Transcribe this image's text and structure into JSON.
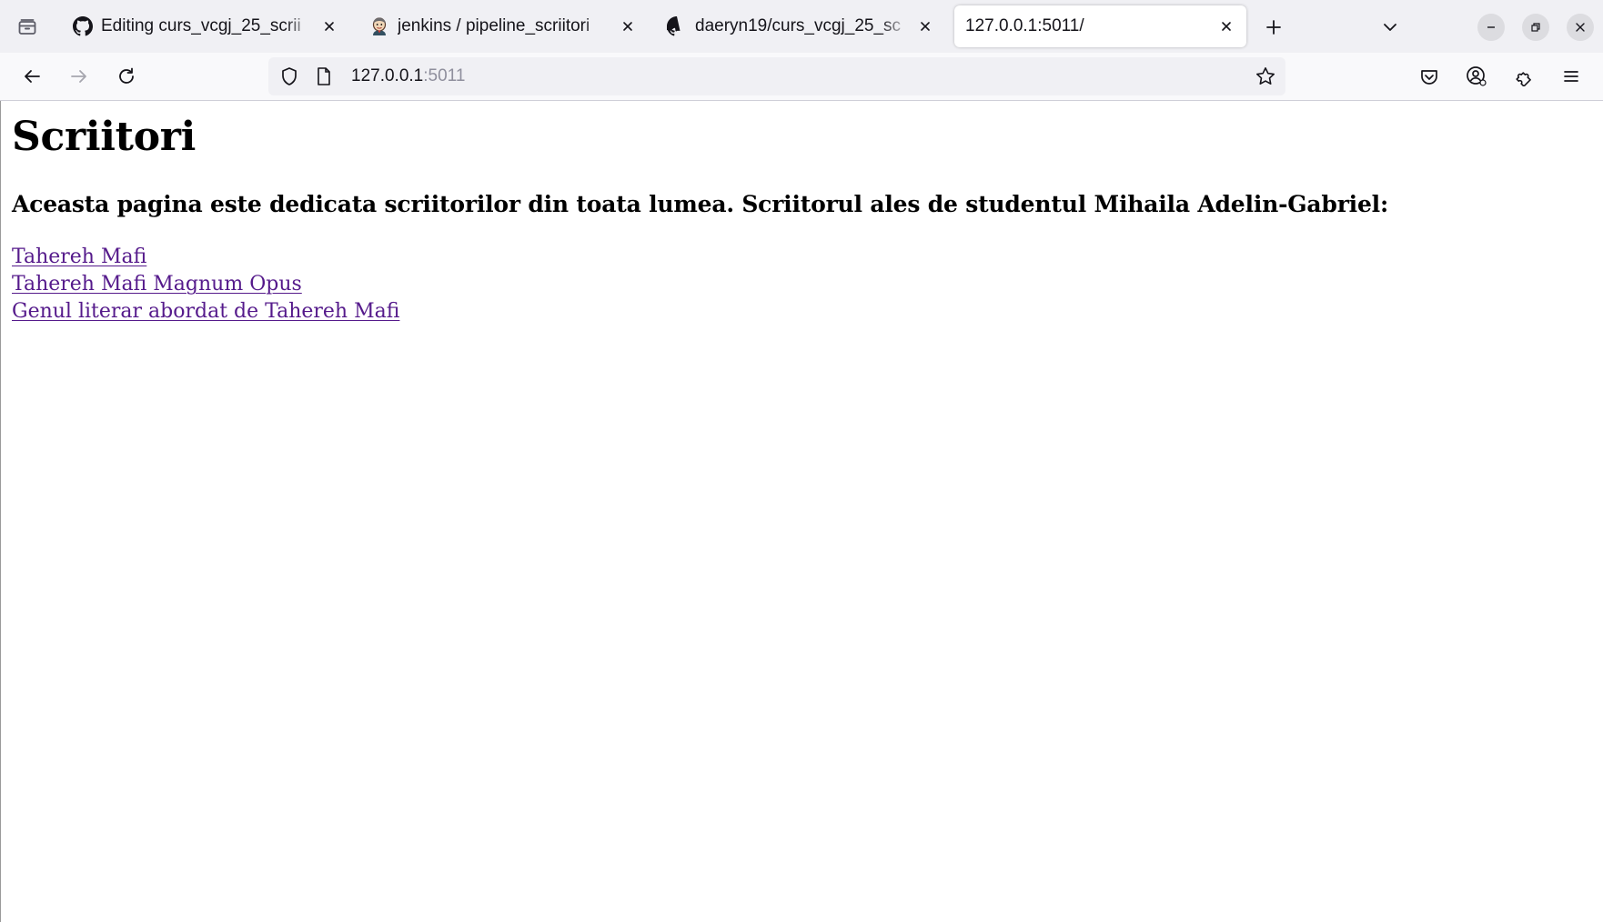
{
  "browser": {
    "tabs": [
      {
        "title": "Editing curs_vcgj_25_scrii",
        "icon": "github-icon",
        "active": false
      },
      {
        "title": "jenkins / pipeline_scriitori",
        "icon": "jenkins-icon",
        "active": false
      },
      {
        "title": "daeryn19/curs_vcgj_25_sc",
        "icon": "github-icon",
        "active": false
      },
      {
        "title": "127.0.0.1:5011/",
        "icon": "",
        "active": true
      }
    ],
    "address_bar": {
      "host": "127.0.0.1",
      "port": ":5011"
    },
    "accent_colors": {
      "tabstrip_bg": "#f0f0f4",
      "navbar_bg": "#f9f9fb",
      "visited_link": "#551a8b"
    }
  },
  "page": {
    "title": "Scriitori",
    "subtitle": "Aceasta pagina este dedicata scriitorilor din toata lumea. Scriitorul ales de studentul Mihaila Adelin-Gabriel:",
    "links": [
      "Tahereh Mafi",
      "Tahereh Mafi Magnum Opus",
      "Genul literar abordat de Tahereh Mafi"
    ]
  }
}
